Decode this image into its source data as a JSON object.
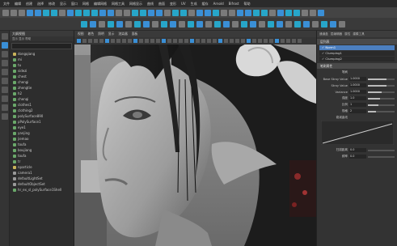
{
  "menubar": {
    "items": [
      "文件",
      "编辑",
      "创建",
      "选择",
      "修改",
      "显示",
      "窗口",
      "网格",
      "编辑网格",
      "网格工具",
      "网格显示",
      "曲线",
      "曲面",
      "变形",
      "UV",
      "生成",
      "缓存",
      "Arnold",
      "Bifrost",
      "帮助"
    ]
  },
  "outliner": {
    "title": "大纲视图",
    "menu": "显示  显示  帮助",
    "items": [
      {
        "label": "dongqiang",
        "kind": "group"
      },
      {
        "label": "mi",
        "kind": "mesh"
      },
      {
        "label": "tu",
        "kind": "mesh"
      },
      {
        "label": "sidezi",
        "kind": "mesh"
      },
      {
        "label": "chest",
        "kind": "mesh"
      },
      {
        "label": "chengi",
        "kind": "mesh"
      },
      {
        "label": "zhengtie",
        "kind": "mesh"
      },
      {
        "label": "h2",
        "kind": "mesh"
      },
      {
        "label": "chenqi",
        "kind": "mesh"
      },
      {
        "label": "clothes1",
        "kind": "mesh"
      },
      {
        "label": "clothing2",
        "kind": "mesh"
      },
      {
        "label": "polySurface890",
        "kind": "mesh"
      },
      {
        "label": "pPolySurface1",
        "kind": "mesh"
      },
      {
        "label": "eye1",
        "kind": "mesh"
      },
      {
        "label": "yanjing",
        "kind": "mesh"
      },
      {
        "label": "jiemao",
        "kind": "mesh"
      },
      {
        "label": "toufa",
        "kind": "mesh"
      },
      {
        "label": "boujiang",
        "kind": "mesh"
      },
      {
        "label": "toufa",
        "kind": "mesh"
      },
      {
        "label": "tr",
        "kind": "mesh"
      },
      {
        "label": "nparticle",
        "kind": "group"
      },
      {
        "label": "camera1",
        "kind": "camera"
      },
      {
        "label": "defaultLightSet",
        "kind": "camera"
      },
      {
        "label": "defaultObjectSet",
        "kind": "camera"
      },
      {
        "label": "hr_ex_sl_polySurface1Shell",
        "kind": "mesh"
      }
    ]
  },
  "viewport": {
    "menu": [
      "视图",
      "着色",
      "照明",
      "显示",
      "渲染器",
      "面板"
    ]
  },
  "attr_editor": {
    "tabs": [
      "通道盒",
      "层编辑器",
      "属性",
      "建模工具"
    ],
    "layers_section": "层列表",
    "layers": [
      {
        "label": "Norm1",
        "selected": true
      },
      {
        "label": "Clumping1",
        "selected": false
      },
      {
        "label": "Clumping2",
        "selected": false
      }
    ],
    "attr_section": "笔刷属性",
    "sub": "笔刷",
    "rows": [
      {
        "label": "Base Stray Value",
        "value": "1.0000",
        "fill": 0.7
      },
      {
        "label": "Stray Value",
        "value": "1.0000",
        "fill": 0.7
      },
      {
        "label": "Variance",
        "value": "1.0000",
        "fill": 0.5
      },
      {
        "label": "强度",
        "value": "1.0",
        "fill": 0.45
      },
      {
        "label": "比例",
        "value": "1",
        "fill": 0.4
      },
      {
        "label": "规格",
        "value": "2",
        "fill": 0.3
      }
    ],
    "falloff_label": "衰减曲线",
    "bottom_rows": [
      {
        "label": "扫描距离",
        "value": "0.0",
        "fill": 0.0
      },
      {
        "label": "频率",
        "value": "0.0",
        "fill": 0.0
      }
    ]
  }
}
